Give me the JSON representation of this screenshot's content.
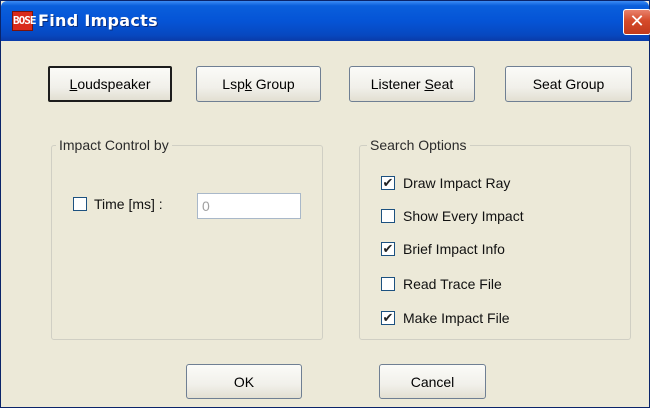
{
  "window": {
    "title": "Find Impacts",
    "app_icon_text": "BOSE",
    "close_glyph": "✕",
    "accent_color": "#0554d6"
  },
  "toolbar": {
    "buttons": [
      {
        "pre": "",
        "key": "L",
        "post": "oudspeaker",
        "default": true
      },
      {
        "pre": "Lsp",
        "key": "k",
        "post": " Group",
        "default": false
      },
      {
        "pre": "Listener ",
        "key": "S",
        "post": "eat",
        "default": false
      },
      {
        "pre": "Seat Group",
        "key": "",
        "post": "",
        "default": false
      }
    ]
  },
  "impact_control": {
    "title": "Impact Control by",
    "time_label": "Time [ms] :",
    "time_checked": false,
    "time_value": "0"
  },
  "search_options": {
    "title": "Search Options",
    "items": [
      {
        "label": "Draw Impact Ray",
        "checked": true,
        "mark": "✔"
      },
      {
        "label": "Show Every Impact",
        "checked": false,
        "mark": ""
      },
      {
        "label": "Brief Impact Info",
        "checked": true,
        "mark": "✔"
      },
      {
        "label": "Read Trace File",
        "checked": false,
        "mark": ""
      },
      {
        "label": "Make Impact File",
        "checked": true,
        "mark": "✔"
      }
    ]
  },
  "footer": {
    "ok_label": "OK",
    "cancel_label": "Cancel"
  }
}
